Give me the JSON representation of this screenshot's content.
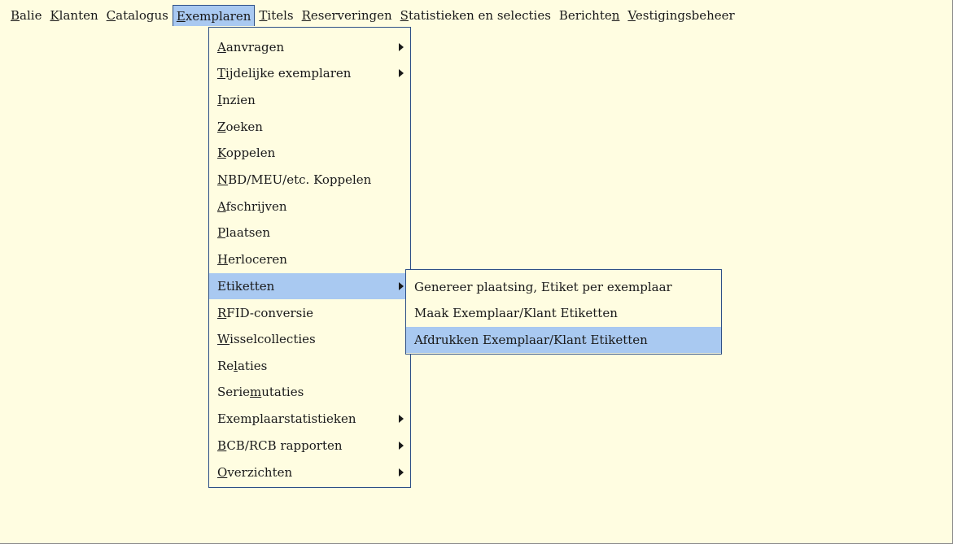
{
  "menubar": {
    "items": [
      {
        "pre": "",
        "key": "B",
        "post": "alie"
      },
      {
        "pre": "",
        "key": "K",
        "post": "lanten"
      },
      {
        "pre": "",
        "key": "C",
        "post": "atalogus"
      },
      {
        "pre": "",
        "key": "E",
        "post": "xemplaren"
      },
      {
        "pre": "",
        "key": "T",
        "post": "itels"
      },
      {
        "pre": "",
        "key": "R",
        "post": "eserveringen"
      },
      {
        "pre": "",
        "key": "S",
        "post": "tatistieken en selecties"
      },
      {
        "pre": "Berichte",
        "key": "n",
        "post": ""
      },
      {
        "pre": "",
        "key": "V",
        "post": "estigingsbeheer"
      }
    ]
  },
  "exemplaren_menu": {
    "items": [
      {
        "pre": "",
        "key": "A",
        "post": "anvragen",
        "submenu": true
      },
      {
        "pre": "",
        "key": "T",
        "post": "ijdelijke exemplaren",
        "submenu": true
      },
      {
        "pre": "",
        "key": "I",
        "post": "nzien",
        "submenu": false
      },
      {
        "pre": "",
        "key": "Z",
        "post": "oeken",
        "submenu": false
      },
      {
        "pre": "",
        "key": "K",
        "post": "oppelen",
        "submenu": false
      },
      {
        "pre": "",
        "key": "N",
        "post": "BD/MEU/etc. Koppelen",
        "submenu": false
      },
      {
        "pre": "",
        "key": "A",
        "post": "fschrijven",
        "submenu": false
      },
      {
        "pre": "",
        "key": "P",
        "post": "laatsen",
        "submenu": false
      },
      {
        "pre": "",
        "key": "H",
        "post": "erloceren",
        "submenu": false
      },
      {
        "pre": "Etiketten",
        "key": "",
        "post": "",
        "submenu": true
      },
      {
        "pre": "",
        "key": "R",
        "post": "FID-conversie",
        "submenu": false
      },
      {
        "pre": "",
        "key": "W",
        "post": "isselcollecties",
        "submenu": false
      },
      {
        "pre": "Re",
        "key": "l",
        "post": "aties",
        "submenu": false
      },
      {
        "pre": "Serie",
        "key": "m",
        "post": "utaties",
        "submenu": false
      },
      {
        "pre": "Exemplaarstatistieken",
        "key": "",
        "post": "",
        "submenu": true
      },
      {
        "pre": "",
        "key": "B",
        "post": "CB/RCB rapporten",
        "submenu": true
      },
      {
        "pre": "",
        "key": "O",
        "post": "verzichten",
        "submenu": true
      }
    ]
  },
  "etiketten_submenu": {
    "items": [
      {
        "label": "Genereer plaatsing, Etiket per exemplaar"
      },
      {
        "label": "Maak Exemplaar/Klant Etiketten"
      },
      {
        "label": "Afdrukken Exemplaar/Klant Etiketten"
      }
    ]
  },
  "colors": {
    "background": "#fffde1",
    "highlight": "#a9c9f1",
    "border": "#2d4f86"
  },
  "icons": {
    "submenu_arrow": "triangle-right-icon"
  }
}
